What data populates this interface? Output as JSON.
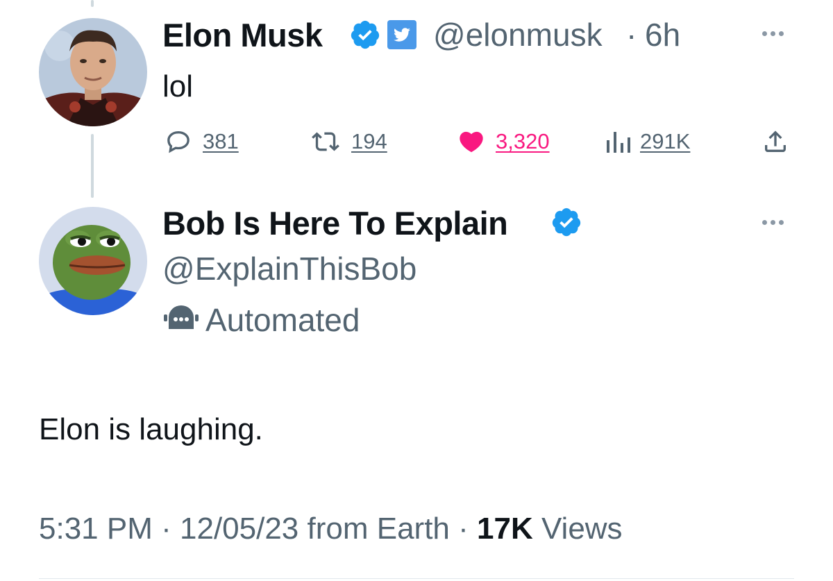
{
  "tweet": {
    "author_name": "Elon Musk",
    "handle": "@elonmusk",
    "separator": "·",
    "time_ago": "6h",
    "text": "lol",
    "stats": {
      "replies": "381",
      "retweets": "194",
      "likes": "3,320",
      "views": "291K"
    },
    "colors": {
      "like": "#f91880",
      "verified": "#1d9bf0",
      "twitter_badge": "#4a99e9"
    },
    "icons": [
      "verified-badge-icon",
      "twitter-bird-badge-icon",
      "reply-icon",
      "retweet-icon",
      "heart-icon",
      "views-chart-icon",
      "share-icon",
      "more-options-icon"
    ]
  },
  "reply": {
    "author_name": "Bob Is Here To Explain",
    "handle": "@ExplainThisBob",
    "automated_label": "Automated",
    "text": "Elon is laughing.",
    "icons": [
      "verified-badge-icon",
      "bot-icon",
      "more-options-icon"
    ]
  },
  "footer": {
    "time": "5:31 PM",
    "sep1": "·",
    "date": "12/05/23",
    "location": "from Earth",
    "sep2": "·",
    "views_count": "17K",
    "views_label": "Views"
  }
}
